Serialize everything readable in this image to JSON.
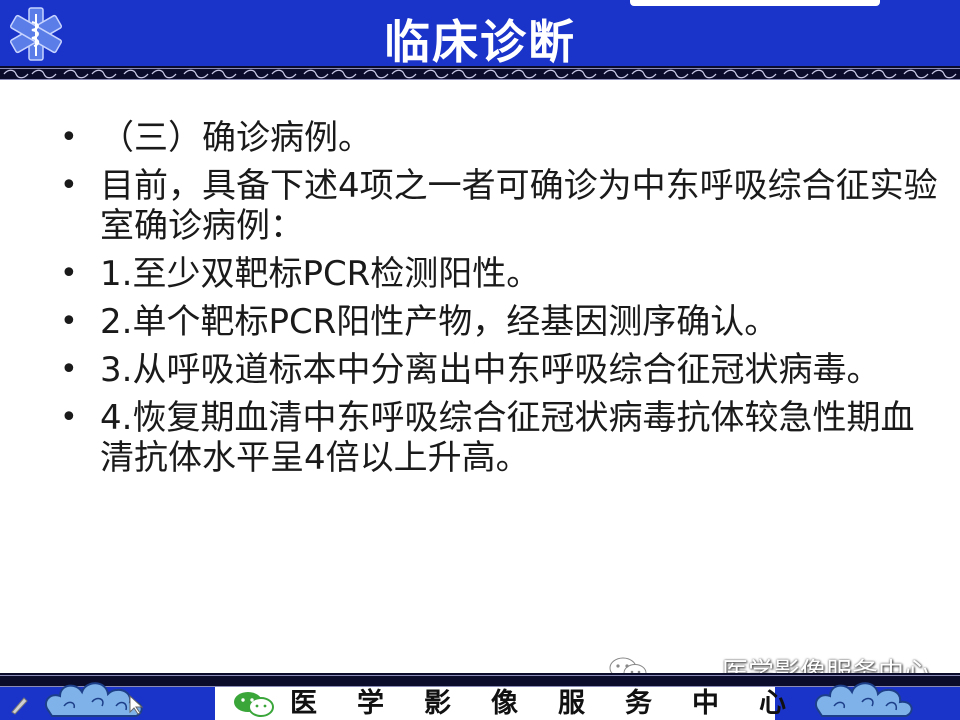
{
  "header": {
    "title": "临床诊断"
  },
  "bullets": [
    {
      "text": "（三）确诊病例。"
    },
    {
      "text": "目前，具备下述4项之一者可确诊为中东呼吸综合征实验室确诊病例："
    },
    {
      "text": "1.至少双靶标PCR检测阳性。"
    },
    {
      "text": "2.单个靶标PCR阳性产物，经基因测序确认。"
    },
    {
      "text": "3.从呼吸道标本中分离出中东呼吸综合征冠状病毒。"
    },
    {
      "text": "4.恢复期血清中东呼吸综合征冠状病毒抗体较急性期血清抗体水平呈4倍以上升高。"
    }
  ],
  "bullet_marker": "•",
  "footer": {
    "text": "医学影像服务中心"
  },
  "watermark": {
    "text": "医学影像服务中心"
  },
  "colors": {
    "header_blue": "#1a33c9",
    "border_dark": "#0b0b2b",
    "text": "#1a1a1a"
  },
  "icons": [
    "star-of-life-icon",
    "wechat-icon",
    "cloud-ornament-icon",
    "pen-tool-icon",
    "pointer-icon"
  ]
}
